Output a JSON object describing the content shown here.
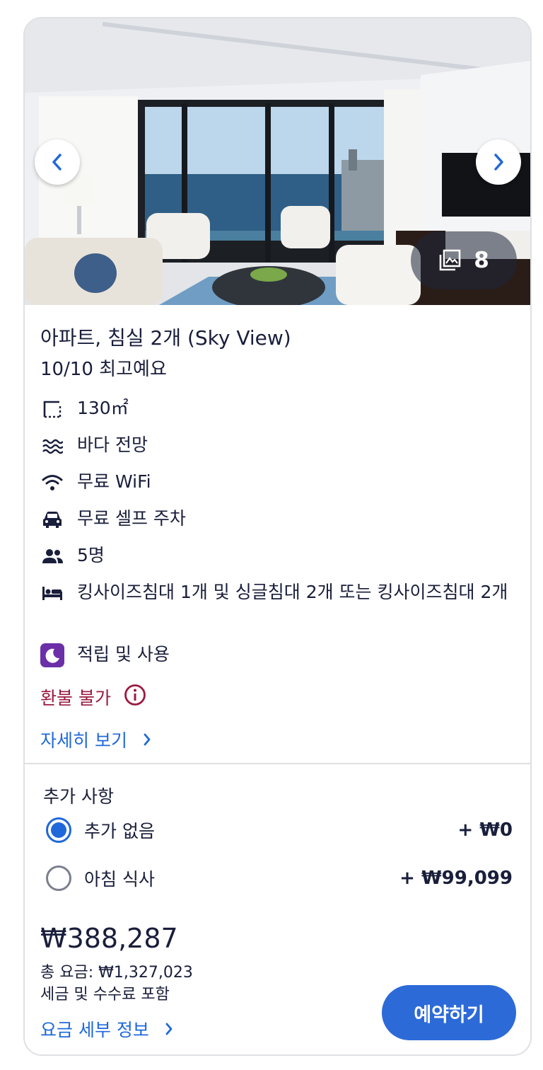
{
  "room": {
    "title": "아파트, 침실 2개 (Sky View)",
    "rating": "10/10 최고예요"
  },
  "gallery": {
    "photo_count": "8",
    "icons": {
      "prev": "chevron-left-icon",
      "next": "chevron-right-icon",
      "gallery": "image-stack-icon"
    }
  },
  "amenities": [
    {
      "icon": "area-icon",
      "text": "130㎡"
    },
    {
      "icon": "waves-icon",
      "text": "바다 전망"
    },
    {
      "icon": "wifi-icon",
      "text": "무료 WiFi"
    },
    {
      "icon": "car-icon",
      "text": "무료 셀프 주차"
    },
    {
      "icon": "people-icon",
      "text": "5명"
    },
    {
      "icon": "bed-icon",
      "text": "킹사이즈침대 1개 및 싱글침대 2개 또는 킹사이즈침대 2개"
    },
    {
      "icon": "moon-icon",
      "text": "적립 및 사용"
    }
  ],
  "refund": {
    "text": "환불 불가",
    "icon": "info-icon"
  },
  "more_link": "자세히 보기",
  "extras": {
    "title": "추가 사항",
    "options": [
      {
        "label": "추가 없음",
        "price": "+ ₩0",
        "selected": true
      },
      {
        "label": "아침 식사",
        "price": "+ ₩99,099",
        "selected": false
      }
    ]
  },
  "pricing": {
    "nightly": "₩388,287",
    "total": "총 요금: ₩1,327,023",
    "tax_note": "세금 및 수수료 포함",
    "details_link": "요금 세부 정보"
  },
  "reserve_label": "예약하기",
  "colors": {
    "primary": "#1f68d9",
    "button": "#2c6ad8",
    "refund": "#9a1b40",
    "text": "#191e3b",
    "loyalty": "#6b2fa8"
  }
}
